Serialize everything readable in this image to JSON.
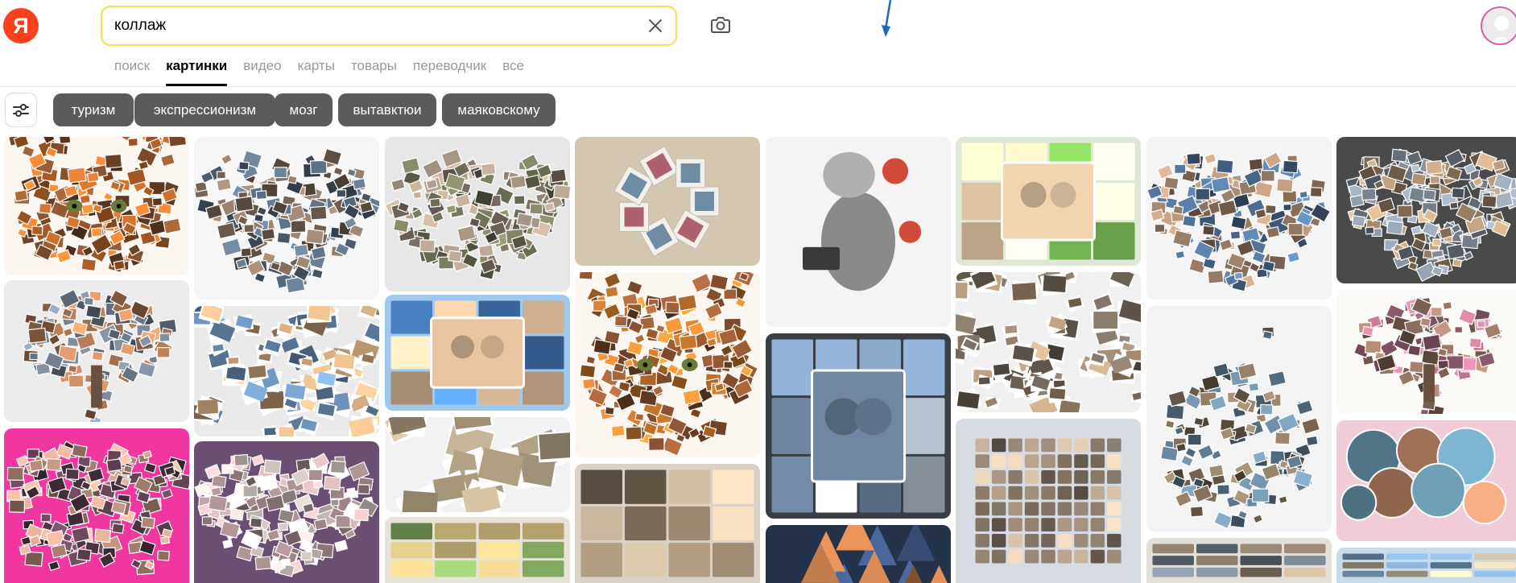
{
  "logo": {
    "letter": "Я"
  },
  "search": {
    "value": "коллаж"
  },
  "tabs": [
    {
      "label": "поиск",
      "active": false
    },
    {
      "label": "картинки",
      "active": true
    },
    {
      "label": "видео",
      "active": false
    },
    {
      "label": "карты",
      "active": false
    },
    {
      "label": "товары",
      "active": false
    },
    {
      "label": "переводчик",
      "active": false
    },
    {
      "label": "все",
      "active": false
    }
  ],
  "chips": [
    "туризм",
    "экспрессионизм",
    "мозг",
    "вытавктюи",
    "маяковскому"
  ],
  "icons": {
    "clear": "close-icon",
    "camera": "camera-search-icon",
    "filters": "sliders-icon",
    "cursor": "mouse-pointer"
  },
  "colors": {
    "logo": "#fc3f1d",
    "search_border": "#ffdb4d",
    "chip_bg": "#5b5b5b",
    "tab_inactive": "#999999",
    "avatar_ring": "#d85ea5"
  },
  "results": [
    {
      "kind": "cat",
      "bg": "#fbf6f0",
      "a": "#c26a2a",
      "b": "#7a4a2a"
    },
    {
      "kind": "blob",
      "bg": "#ececec",
      "a": "#6e7c8c",
      "b": "#b37a55"
    },
    {
      "kind": "butterfly",
      "bg": "#f0369f",
      "a": "#5a3c4c",
      "b": "#b88c7a"
    },
    {
      "kind": "heart",
      "bg": "#f6f6f6",
      "a": "#7d6a5a",
      "b": "#556677"
    },
    {
      "kind": "scatter",
      "bg": "#eaeaea",
      "a": "#6b8fb5",
      "b": "#c9a37a"
    },
    {
      "kind": "heart",
      "bg": "#6a4f73",
      "a": "#e9dcd8",
      "b": "#b99c9e"
    },
    {
      "kind": "heart",
      "bg": "#e7e7e7",
      "a": "#6d6f55",
      "b": "#9b8b7b"
    },
    {
      "kind": "family",
      "bg": "#9ec9ee",
      "a": "#4d8ad1",
      "b": "#e8c4a0"
    },
    {
      "kind": "polaroid",
      "bg": "#f2f2f2",
      "a": "#8a7d66",
      "b": "#c8b89a"
    },
    {
      "kind": "mosaic",
      "bg": "#e6e2d6",
      "a": "#7a9d5a",
      "b": "#c7b27a"
    },
    {
      "kind": "spiral",
      "bg": "#d4c7b0",
      "a": "#c06b7a",
      "b": "#7a9bb5"
    },
    {
      "kind": "cat",
      "bg": "#fbf6f0",
      "a": "#c9782e",
      "b": "#8a5230"
    },
    {
      "kind": "wall",
      "bg": "#d9d2c4",
      "a": "#bfae95",
      "b": "#8a7a63"
    },
    {
      "kind": "face",
      "bg": "#f4f4f4",
      "a": "#5a5a5a",
      "b": "#d24a3a"
    },
    {
      "kind": "board",
      "bg": "#3b3f45",
      "a": "#c9d7e6",
      "b": "#6f87a3"
    },
    {
      "kind": "triangles",
      "bg": "#24324a",
      "a": "#4f6fa8",
      "b": "#c07a4a"
    },
    {
      "kind": "frame",
      "bg": "#dfe7d6",
      "a": "#6aa34a",
      "b": "#f2d4b0"
    },
    {
      "kind": "scatter",
      "bg": "#f0f0f0",
      "a": "#6d6257",
      "b": "#a88f73"
    },
    {
      "kind": "grid",
      "bg": "#d6dce2",
      "a": "#8a7a6a",
      "b": "#b5a48f"
    },
    {
      "kind": "heart",
      "bg": "#f4f4f4",
      "a": "#4c6b8f",
      "b": "#a1826a"
    },
    {
      "kind": "apple",
      "bg": "#f3f3f3",
      "a": "#7a6a55",
      "b": "#5f7a8f"
    },
    {
      "kind": "mosaic",
      "bg": "#e2dfd9",
      "a": "#a0907a",
      "b": "#6f7a85"
    },
    {
      "kind": "heart",
      "bg": "#4a4a4a",
      "a": "#a58a6c",
      "b": "#7d8793"
    },
    {
      "kind": "tree",
      "bg": "#fbfaf7",
      "a": "#8a6a5a",
      "b": "#b5728a"
    },
    {
      "kind": "circles",
      "bg": "#f2cbd8",
      "a": "#c48b6a",
      "b": "#6fa0b8"
    },
    {
      "kind": "mosaic",
      "bg": "#c9dbe9",
      "a": "#7aa0c2",
      "b": "#d8c7a8"
    }
  ]
}
